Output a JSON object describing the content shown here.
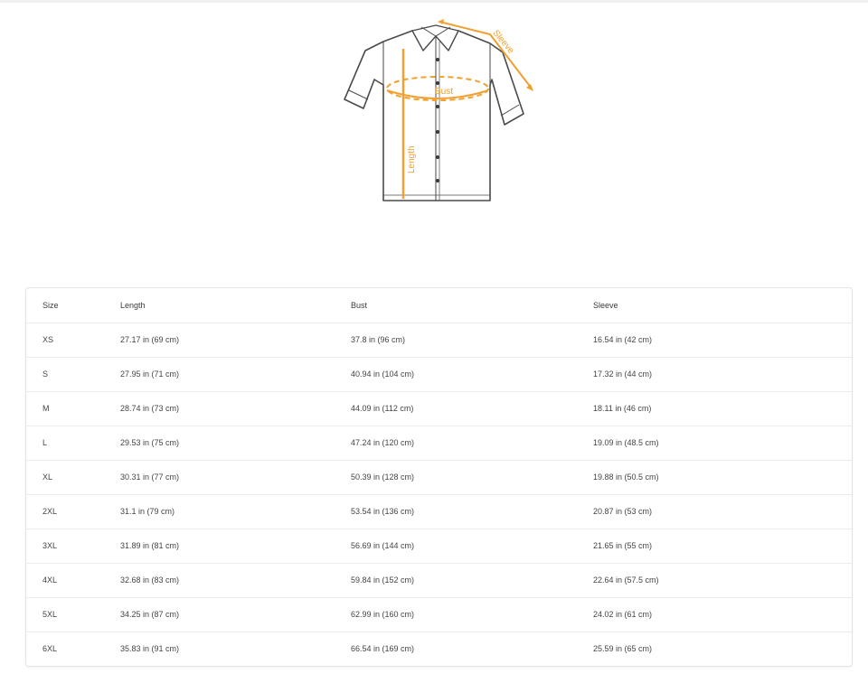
{
  "diagram": {
    "labels": {
      "sleeve": "Sleeve",
      "bust": "Bust",
      "length": "Length"
    },
    "colors": {
      "accent": "#f0a030",
      "outline": "#4a4a4a"
    }
  },
  "table": {
    "headers": [
      "Size",
      "Length",
      "Bust",
      "Sleeve"
    ],
    "rows": [
      [
        "XS",
        "27.17 in (69 cm)",
        "37.8 in (96 cm)",
        "16.54 in (42 cm)"
      ],
      [
        "S",
        "27.95 in (71 cm)",
        "40.94 in (104 cm)",
        "17.32 in (44 cm)"
      ],
      [
        "M",
        "28.74 in (73 cm)",
        "44.09 in (112 cm)",
        "18.11 in (46 cm)"
      ],
      [
        "L",
        "29.53 in (75 cm)",
        "47.24 in (120 cm)",
        "19.09 in (48.5 cm)"
      ],
      [
        "XL",
        "30.31 in (77 cm)",
        "50.39 in (128 cm)",
        "19.88 in (50.5 cm)"
      ],
      [
        "2XL",
        "31.1 in (79 cm)",
        "53.54 in (136 cm)",
        "20.87 in (53 cm)"
      ],
      [
        "3XL",
        "31.89 in (81 cm)",
        "56.69 in (144 cm)",
        "21.65 in (55 cm)"
      ],
      [
        "4XL",
        "32.68 in (83 cm)",
        "59.84 in (152 cm)",
        "22.64 in (57.5 cm)"
      ],
      [
        "5XL",
        "34.25 in (87 cm)",
        "62.99 in (160 cm)",
        "24.02 in (61 cm)"
      ],
      [
        "6XL",
        "35.83 in (91 cm)",
        "66.54 in (169 cm)",
        "25.59 in (65 cm)"
      ]
    ]
  }
}
